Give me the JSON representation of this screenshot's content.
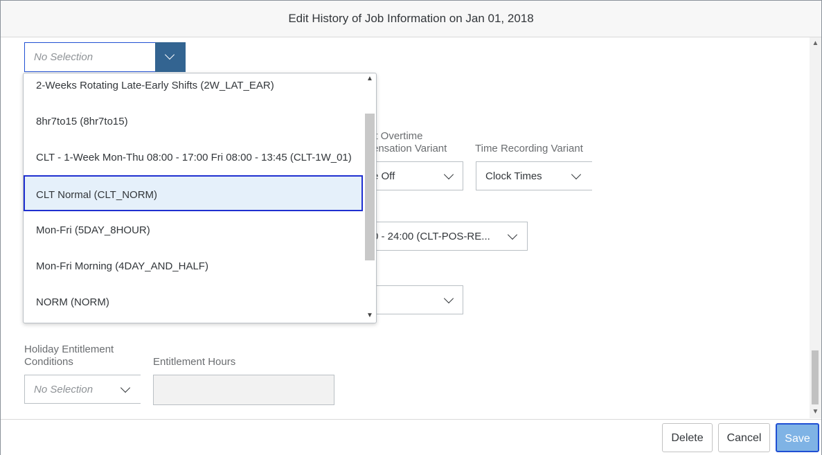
{
  "dialog": {
    "title": "Edit History of Job Information on Jan 01, 2018"
  },
  "top_select": {
    "placeholder": "No Selection"
  },
  "dropdown": {
    "items": [
      "2-Weeks Rotating Late-Early Shifts (2W_LAT_EAR)",
      "8hr7to15 (8hr7to15)",
      "CLT - 1-Week Mon-Thu 08:00 - 17:00 Fri 08:00 - 13:45 (CLT-1W_01)",
      "CLT Normal (CLT_NORM)",
      "Mon-Fri (5DAY_8HOUR)",
      "Mon-Fri Morning (4DAY_AND_HALF)",
      "NORM (NORM)"
    ],
    "selected": "CLT Normal (CLT_NORM)"
  },
  "fields": {
    "overtime_label_line1": "lt Overtime",
    "overtime_label_line2": "ensation Variant",
    "overtime_value": "e Off",
    "time_recording_label": "Time Recording Variant",
    "time_recording_value": "Clock Times",
    "work_schedule_value": "0 - 24:00 (CLT-POS-RE...",
    "empty_select_value": "",
    "holiday_label_line1": "Holiday Entitlement",
    "holiday_label_line2": "Conditions",
    "holiday_value": "No Selection",
    "entitlement_hours_label": "Entitlement Hours",
    "entitlement_hours_value": ""
  },
  "footer": {
    "delete_label": "Delete",
    "cancel_label": "Cancel",
    "save_label": "Save"
  },
  "icons": {
    "chevron": "chevron-down-icon",
    "scroll_up": "caret-up-icon",
    "scroll_down": "caret-down-icon"
  }
}
